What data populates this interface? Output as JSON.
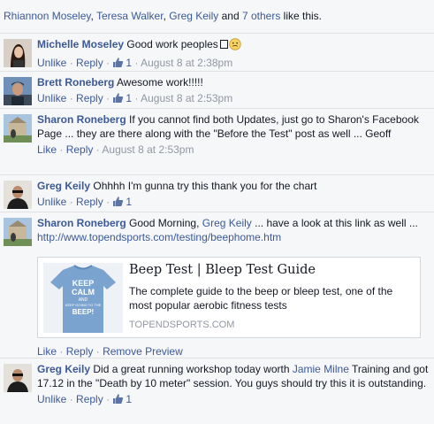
{
  "likes": {
    "names": [
      "Rhiannon Moseley",
      "Teresa Walker",
      "Greg Keily"
    ],
    "separator": ", ",
    "and_text": " and ",
    "others": "7 others",
    "suffix": " like this."
  },
  "comments": [
    {
      "author": "Michelle Moseley",
      "text": "Good work peoples",
      "unlike": "Unlike",
      "reply": "Reply",
      "like_count": "1",
      "timestamp": "August 8 at 2:38pm"
    },
    {
      "author": "Brett Roneberg",
      "text": "Awesome work!!!!!",
      "unlike": "Unlike",
      "reply": "Reply",
      "like_count": "1",
      "timestamp": "August 8 at 2:53pm"
    },
    {
      "author": "Sharon Roneberg",
      "text": "If you cannot find both Updates, just go to Sharon's Facebook Page ... they are there along with the \"Before the Test\" post as well ... Geoff",
      "like": "Like",
      "reply": "Reply",
      "timestamp": "August 8 at 2:53pm"
    },
    {
      "author": "Greg Keily",
      "text": "Ohhhh I'm gunna try this thank you for the chart",
      "unlike": "Unlike",
      "reply": "Reply",
      "like_count": "1"
    },
    {
      "author": "Sharon Roneberg",
      "text_before": "Good Morning, ",
      "mention": "Greg Keily",
      "text_after": " ... have a look at this link as well ...",
      "link": "http://www.topendsports.com/testing/beephome.htm",
      "like": "Like",
      "reply": "Reply",
      "remove_preview": "Remove Preview"
    },
    {
      "author": "Greg Keily",
      "text_before": "Did a great running workshop today worth ",
      "mention": "Jamie Milne",
      "text_after": " Training and got 17.12 in the \"Death by 10 meter\" session. You guys should try this it is outstanding.",
      "unlike": "Unlike",
      "reply": "Reply",
      "like_count": "1"
    }
  ],
  "preview": {
    "title": "Beep Test | Bleep Test Guide",
    "description": "The complete guide to the beep or bleep test, one of the most popular aerobic fitness tests",
    "domain": "TOPENDSPORTS.COM",
    "shirt_text": [
      "KEEP",
      "CALM",
      "AND",
      "KEEP GOING TO THE",
      "BEEP!"
    ]
  },
  "colors": {
    "link": "#3b5998",
    "meta": "#9197a3",
    "background": "#f6f7f9",
    "shirt": "#7ba3cf"
  },
  "icons": [
    "thumbs-up-icon",
    "smiley-face-icon"
  ]
}
